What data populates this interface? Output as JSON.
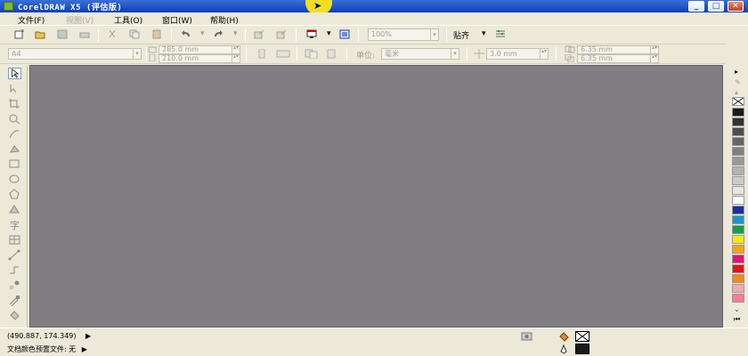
{
  "window": {
    "title": "CorelDRAW X5 (评估版)",
    "minimize_glyph": "_",
    "maximize_glyph": "□",
    "close_glyph": "✕"
  },
  "menu": [
    {
      "label": "文件(F)",
      "enabled": true
    },
    {
      "label": "视图(V)",
      "enabled": false
    },
    {
      "label": "工具(O)",
      "enabled": true
    },
    {
      "label": "窗口(W)",
      "enabled": true
    },
    {
      "label": "帮助(H)",
      "enabled": true
    }
  ],
  "standard_toolbar": {
    "zoom_value": "100%",
    "snap_label": "贴齐"
  },
  "property_bar": {
    "paper_size": "A4",
    "width_value": "285.0 mm",
    "height_value": "210.0 mm",
    "units_label": "单位:",
    "units_value": "毫米",
    "nudge_value": "3.0 mm",
    "dup_x_value": "6.35 mm",
    "dup_y_value": "6.35 mm"
  },
  "status": {
    "coordinates": "(490.887, 174.349)",
    "color_profile": "文档颜色预置文件: 无",
    "arrow_glyph": "▶"
  },
  "palette_colors": [
    "#1a1a1a",
    "#333333",
    "#4d4d4d",
    "#666666",
    "#808080",
    "#999999",
    "#b3b3b3",
    "#cccccc",
    "#e6e6e6",
    "#ffffff",
    "#1b2da8",
    "#1598c9",
    "#10a04a",
    "#ffe600",
    "#f5a511",
    "#e2127a",
    "#e3131b",
    "#f08a1a",
    "#f4a8b4",
    "#ff7b95"
  ],
  "colors": {
    "canvas": "#807e82",
    "chrome": "#ece9d8",
    "titlebar": "#0a3fb8"
  }
}
